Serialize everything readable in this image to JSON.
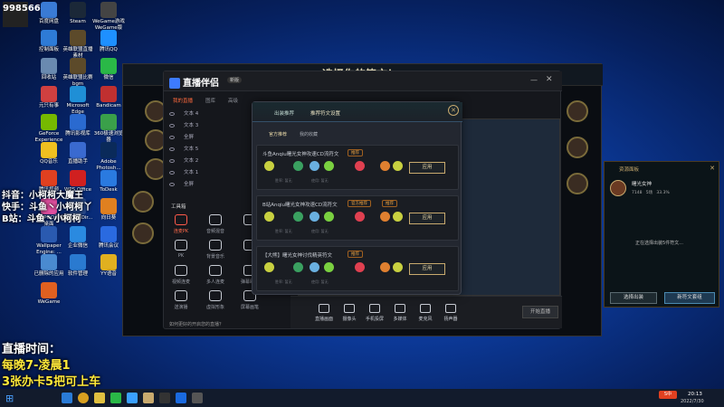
{
  "streamer": {
    "avatar_text": "王\n9985652",
    "id": "9985662"
  },
  "desktop_icons": [
    {
      "label": "百度网盘",
      "color": "#3a7bd5"
    },
    {
      "label": "Steam",
      "color": "#1b2838"
    },
    {
      "label": "WeGame游戏 WeGame版",
      "color": "#444"
    },
    {
      "label": "控制面板",
      "color": "#2e7bd6"
    },
    {
      "label": "英雄联盟直播素材",
      "color": "#5c4a2a"
    },
    {
      "label": "腾讯QQ",
      "color": "#1e90ff"
    },
    {
      "label": "回收站",
      "color": "#6a8ab0"
    },
    {
      "label": "英雄联盟比赛bgm",
      "color": "#5c4a2a"
    },
    {
      "label": "微信",
      "color": "#2ab847"
    },
    {
      "label": "元只有事",
      "color": "#d04040"
    },
    {
      "label": "Microsoft Edge",
      "color": "#1f8fd6"
    },
    {
      "label": "Bandicam",
      "color": "#c03030"
    },
    {
      "label": "GeForce Experience",
      "color": "#76b900"
    },
    {
      "label": "腾讯影视库",
      "color": "#2a6ad0"
    },
    {
      "label": "360极速浏览器",
      "color": "#3aa04a"
    },
    {
      "label": "QQ音乐",
      "color": "#f0c020"
    },
    {
      "label": "直播助手",
      "color": "#3a6ad0"
    },
    {
      "label": "Adobe Photosh...",
      "color": "#0a2a5a"
    },
    {
      "label": "腾讯视频",
      "color": "#e04020"
    },
    {
      "label": "WPS Office",
      "color": "#d02020"
    },
    {
      "label": "ToDesk",
      "color": "#2a7ae0"
    },
    {
      "label": "UPUPOO动态桌面",
      "color": "#e050a0"
    },
    {
      "label": "LeagueDir...",
      "color": "#2a4a8a"
    },
    {
      "label": "向日葵",
      "color": "#e08020"
    },
    {
      "label": "Wallpaper Engine: ...",
      "color": "#2a5ab0"
    },
    {
      "label": "企业微信",
      "color": "#2a8ae0"
    },
    {
      "label": "腾讯会议",
      "color": "#2a6ae0"
    },
    {
      "label": "已删除的应用",
      "color": "#4a8ad0"
    },
    {
      "label": "软件管理",
      "color": "#2a7ad0"
    },
    {
      "label": "YY语音",
      "color": "#e0b020"
    },
    {
      "label": "WeGame",
      "color": "#e06020"
    }
  ],
  "overlay": {
    "douyin": "抖音：小柯柯大魔王",
    "kuaishou": "快手：斗鱼丶小柯柯丫",
    "bilibili": "B站：斗鱼丶小柯柯",
    "live_title": "直播时间：",
    "live_time": "每晚7-凌晨1",
    "promo": "3张办卡5把可上车"
  },
  "game": {
    "title": "选择你的符文！"
  },
  "obs": {
    "title": "直播伴侣",
    "badge": "新版",
    "tabs": [
      "我的直播",
      "图库",
      "高级",
      "设置"
    ],
    "layers": [
      "文本 4",
      "文本 3",
      "全屏",
      "文本 5",
      "文本 2",
      "文本 1",
      "全屏"
    ],
    "tools_title": "工具箱",
    "tools": [
      {
        "label": "连麦PK",
        "red": true
      },
      {
        "label": "音频混音",
        "red": false
      },
      {
        "label": "",
        "red": false
      },
      {
        "label": "PK",
        "red": false
      },
      {
        "label": "背景音乐",
        "red": false
      },
      {
        "label": "",
        "red": false
      },
      {
        "label": "视频连麦",
        "red": false
      },
      {
        "label": "多人连麦",
        "red": false
      },
      {
        "label": "弹幕助手",
        "red": false
      },
      {
        "label": "送演播",
        "red": false
      },
      {
        "label": "虚拟形象",
        "red": false
      },
      {
        "label": "屏幕画笔",
        "red": false
      }
    ],
    "notice": "如何更好的开启您的直播？",
    "bottom": [
      "直播画面",
      "摄像头",
      "手机投屏",
      "多媒体",
      "麦克风",
      "扬声器"
    ],
    "start_live": "开始直播"
  },
  "dialog": {
    "tabs": [
      "出装推荐",
      "推荐符文设置"
    ],
    "subtabs": [
      "官方推荐",
      "我的收藏"
    ],
    "cards": [
      {
        "name": "斗鱼Anqiu曙光女神攻速CD流符文",
        "tag": "推荐",
        "apply": "应用",
        "meta_a": "胜率: 暂无",
        "meta_b": "使用: 暂无"
      },
      {
        "name": "B站Anqiu曙光女神攻速CD流符文",
        "tag": "官方推荐",
        "tag2": "推荐",
        "apply": "应用",
        "meta_a": "胜率: 暂无",
        "meta_b": "使用: 暂无"
      },
      {
        "name": "【大熊】曙光女神讨伐精英符文",
        "tag": "推荐",
        "apply": "应用",
        "meta_a": "胜率: 暂无",
        "meta_b": "使用: 暂无"
      }
    ]
  },
  "right_panel": {
    "title": "资源面板",
    "champion": "曙光女神",
    "stats": [
      "7148",
      "5场",
      "33.3%"
    ],
    "status": "正在选择出装5件符文...",
    "btn_a": "选择出装",
    "btn_b": "新符文套组"
  },
  "taskbar": {
    "time": "20:13",
    "date": "2022/7/30"
  }
}
